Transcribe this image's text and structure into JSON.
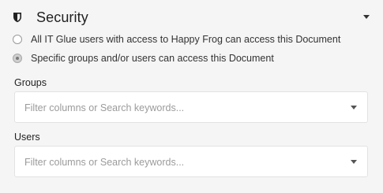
{
  "security": {
    "title": "Security",
    "icon": "shield-icon",
    "toggle_icon": "caret-down-icon",
    "access_options": [
      {
        "label": "All IT Glue users with access to Happy Frog can access this Document",
        "selected": false
      },
      {
        "label": "Specific groups and/or users can access this Document",
        "selected": true
      }
    ],
    "groups": {
      "label": "Groups",
      "placeholder": "Filter columns or Search keywords...",
      "value": ""
    },
    "users": {
      "label": "Users",
      "placeholder": "Filter columns or Search keywords...",
      "value": ""
    }
  },
  "colors": {
    "background": "#f5f5f5",
    "field_background": "#ffffff",
    "field_border": "#e2e2e2",
    "placeholder": "#9b9b9b",
    "text": "#333333"
  }
}
